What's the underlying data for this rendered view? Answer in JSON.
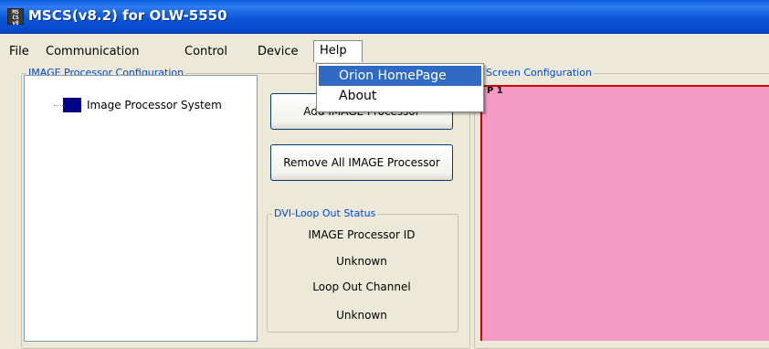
{
  "window": {
    "title": "MSCS(v8.2) for OLW-5550",
    "icon": "app-icon"
  },
  "menu": {
    "items": [
      {
        "label": "File"
      },
      {
        "label": "Communication"
      },
      {
        "label": "Control"
      },
      {
        "label": "Device"
      },
      {
        "label": "Help"
      }
    ],
    "open_dropdown": {
      "parent": "Help",
      "items": [
        {
          "label": "Orion HomePage",
          "highlighted": true
        },
        {
          "label": "About",
          "highlighted": false
        }
      ]
    }
  },
  "image_processor_config": {
    "group_label": "IMAGE Processor Configuration",
    "tree": {
      "root_label": "Image Processor System",
      "icon": "processor-node-icon"
    },
    "buttons": {
      "add_label": "Add IMAGE Processor",
      "remove_all_label": "Remove All IMAGE Processor"
    },
    "dvi_loop_out": {
      "group_label": "DVI-Loop Out Status",
      "processor_id_label": "IMAGE Processor ID",
      "processor_id_value": "Unknown",
      "channel_label": "Loop Out Channel",
      "channel_value": "Unknown"
    }
  },
  "screen_config": {
    "group_label": "Screen Configuration",
    "panel_label": "P 1",
    "colors": {
      "panel_fill": "#f29ac3",
      "panel_border": "#cc0000"
    }
  },
  "colors": {
    "titlebar": "#0b57d8",
    "selection": "#316ac5",
    "group_label": "#0046d5"
  }
}
